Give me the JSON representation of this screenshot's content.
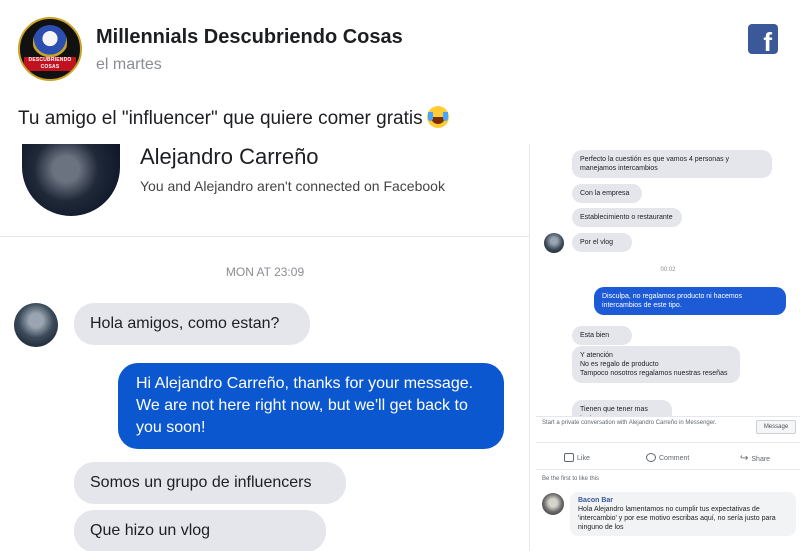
{
  "post": {
    "page_name": "Millennials Descubriendo Cosas",
    "time": "el martes",
    "caption": "Tu amigo el \"influencer\" que quiere comer gratis",
    "logo_text": "DESCUBRIENDO COSAS"
  },
  "chat": {
    "contact_name": "Alejandro Carreño",
    "connection_note": "You and Alejandro aren't connected on Facebook",
    "date_separator": "MON AT 23:09",
    "messages": [
      {
        "from": "contact",
        "text": "Hola amigos, como estan?"
      },
      {
        "from": "page",
        "text": "Hi Alejandro Carreño, thanks for your message. We are not here right now, but we'll get back to you soon!"
      },
      {
        "from": "contact",
        "text": "Somos un grupo de influencers"
      },
      {
        "from": "contact",
        "text": "Que hizo un vlog"
      }
    ]
  },
  "side_chat": {
    "messages": [
      {
        "from": "contact",
        "text": "Perfecto la cuestión es que vamos 4 personas y manejamos intercambios"
      },
      {
        "from": "contact",
        "text": "Con la empresa"
      },
      {
        "from": "contact",
        "text": "Establecimiento o restaurante"
      },
      {
        "from": "contact",
        "text": "Por el vlog"
      },
      {
        "from": "page",
        "text": "Disculpa, no regalamos producto ni hacemos intercambios de este tipo."
      },
      {
        "from": "contact",
        "text": "Esta bien"
      },
      {
        "from": "contact",
        "text": "Y atención\nNo es regalo de producto\nTampoco nosotros regalamos nuestras reseñas"
      },
      {
        "from": "contact",
        "text": "Tienen que tener mas tacto"
      }
    ],
    "time_label": "00:02"
  },
  "comments": {
    "private_hint": "Start a private conversation with Alejandro Carreño in Messenger.",
    "message_button": "Message",
    "like": "Like",
    "comment": "Comment",
    "share": "Share",
    "first_to_like": "Be the first to like this",
    "comment_author": "Bacon Bar",
    "comment_text": "Hola Alejandro lamentamos no cumplir tus expectativas de 'intercambio' y por ese motivo escribas aquí, no sería justo para ninguno de los"
  },
  "colors": {
    "facebook_blue": "#3b5998",
    "messenger_blue": "#0b57d0",
    "bubble_gray": "#e4e6eb"
  }
}
